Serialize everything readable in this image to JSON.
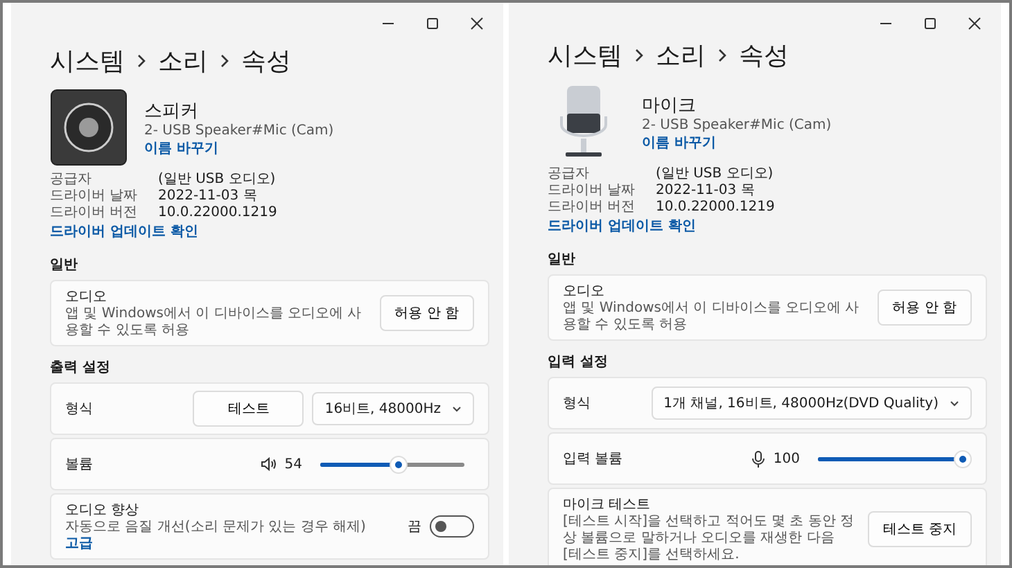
{
  "windows": [
    {
      "breadcrumb": [
        "시스템",
        "소리",
        "속성"
      ],
      "device": {
        "kind": "speaker",
        "name": "스피커",
        "model": "2- USB Speaker#Mic (Cam)",
        "rename_link": "이름 바꾸기"
      },
      "info": [
        {
          "label": "공급자",
          "value": "(일반 USB 오디오)"
        },
        {
          "label": "드라이버 날짜",
          "value": "2022-11-03 목"
        },
        {
          "label": "드라이버 버전",
          "value": "10.0.22000.1219"
        }
      ],
      "driver_update_link": "드라이버 업데이트 확인",
      "sections": [
        {
          "title": "일반",
          "cards": [
            {
              "kind": "button",
              "title": "오디오",
              "description": "앱 및 Windows에서 이 디바이스를 오디오에 사용할 수 있도록 허용",
              "button": "허용 안 함"
            }
          ]
        },
        {
          "title": "출력 설정",
          "cards": [
            {
              "kind": "format",
              "label": "형식",
              "button": "테스트",
              "dropdown": "16비트, 48000Hz"
            },
            {
              "kind": "slider",
              "label": "볼륨",
              "reading": "54",
              "level": 0.54
            },
            {
              "kind": "toggle",
              "title": "오디오 향상",
              "description": "자동으로 음질 개선(소리 문제가 있는 경우 해제)",
              "link": "고급",
              "state_label": "끔",
              "on": false
            }
          ]
        }
      ]
    },
    {
      "breadcrumb": [
        "시스템",
        "소리",
        "속성"
      ],
      "device": {
        "kind": "microphone",
        "name": "마이크",
        "model": "2- USB Speaker#Mic (Cam)",
        "rename_link": "이름 바꾸기"
      },
      "info": [
        {
          "label": "공급자",
          "value": "(일반 USB 오디오)"
        },
        {
          "label": "드라이버 날짜",
          "value": "2022-11-03 목"
        },
        {
          "label": "드라이버 버전",
          "value": "10.0.22000.1219"
        }
      ],
      "driver_update_link": "드라이버 업데이트 확인",
      "sections": [
        {
          "title": "일반",
          "cards": [
            {
              "kind": "button",
              "title": "오디오",
              "description": "앱 및 Windows에서 이 디바이스를 오디오에 사용할 수 있도록 허용",
              "button": "허용 안 함"
            }
          ]
        },
        {
          "title": "입력 설정",
          "cards": [
            {
              "kind": "format",
              "label": "형식",
              "dropdown": "1개 채널, 16비트, 48000Hz(DVD Quality)"
            },
            {
              "kind": "slider",
              "label": "입력 볼륨",
              "reading": "100",
              "level": 1.0
            },
            {
              "kind": "button",
              "title": "마이크 테스트",
              "description": "[테스트 시작]을 선택하고 적어도 몇 초 동안 정상 볼륨으로 말하거나 오디오를 재생한 다음 [테스트 중지]를 선택하세요.",
              "button": "테스트 중지"
            }
          ]
        }
      ]
    }
  ]
}
